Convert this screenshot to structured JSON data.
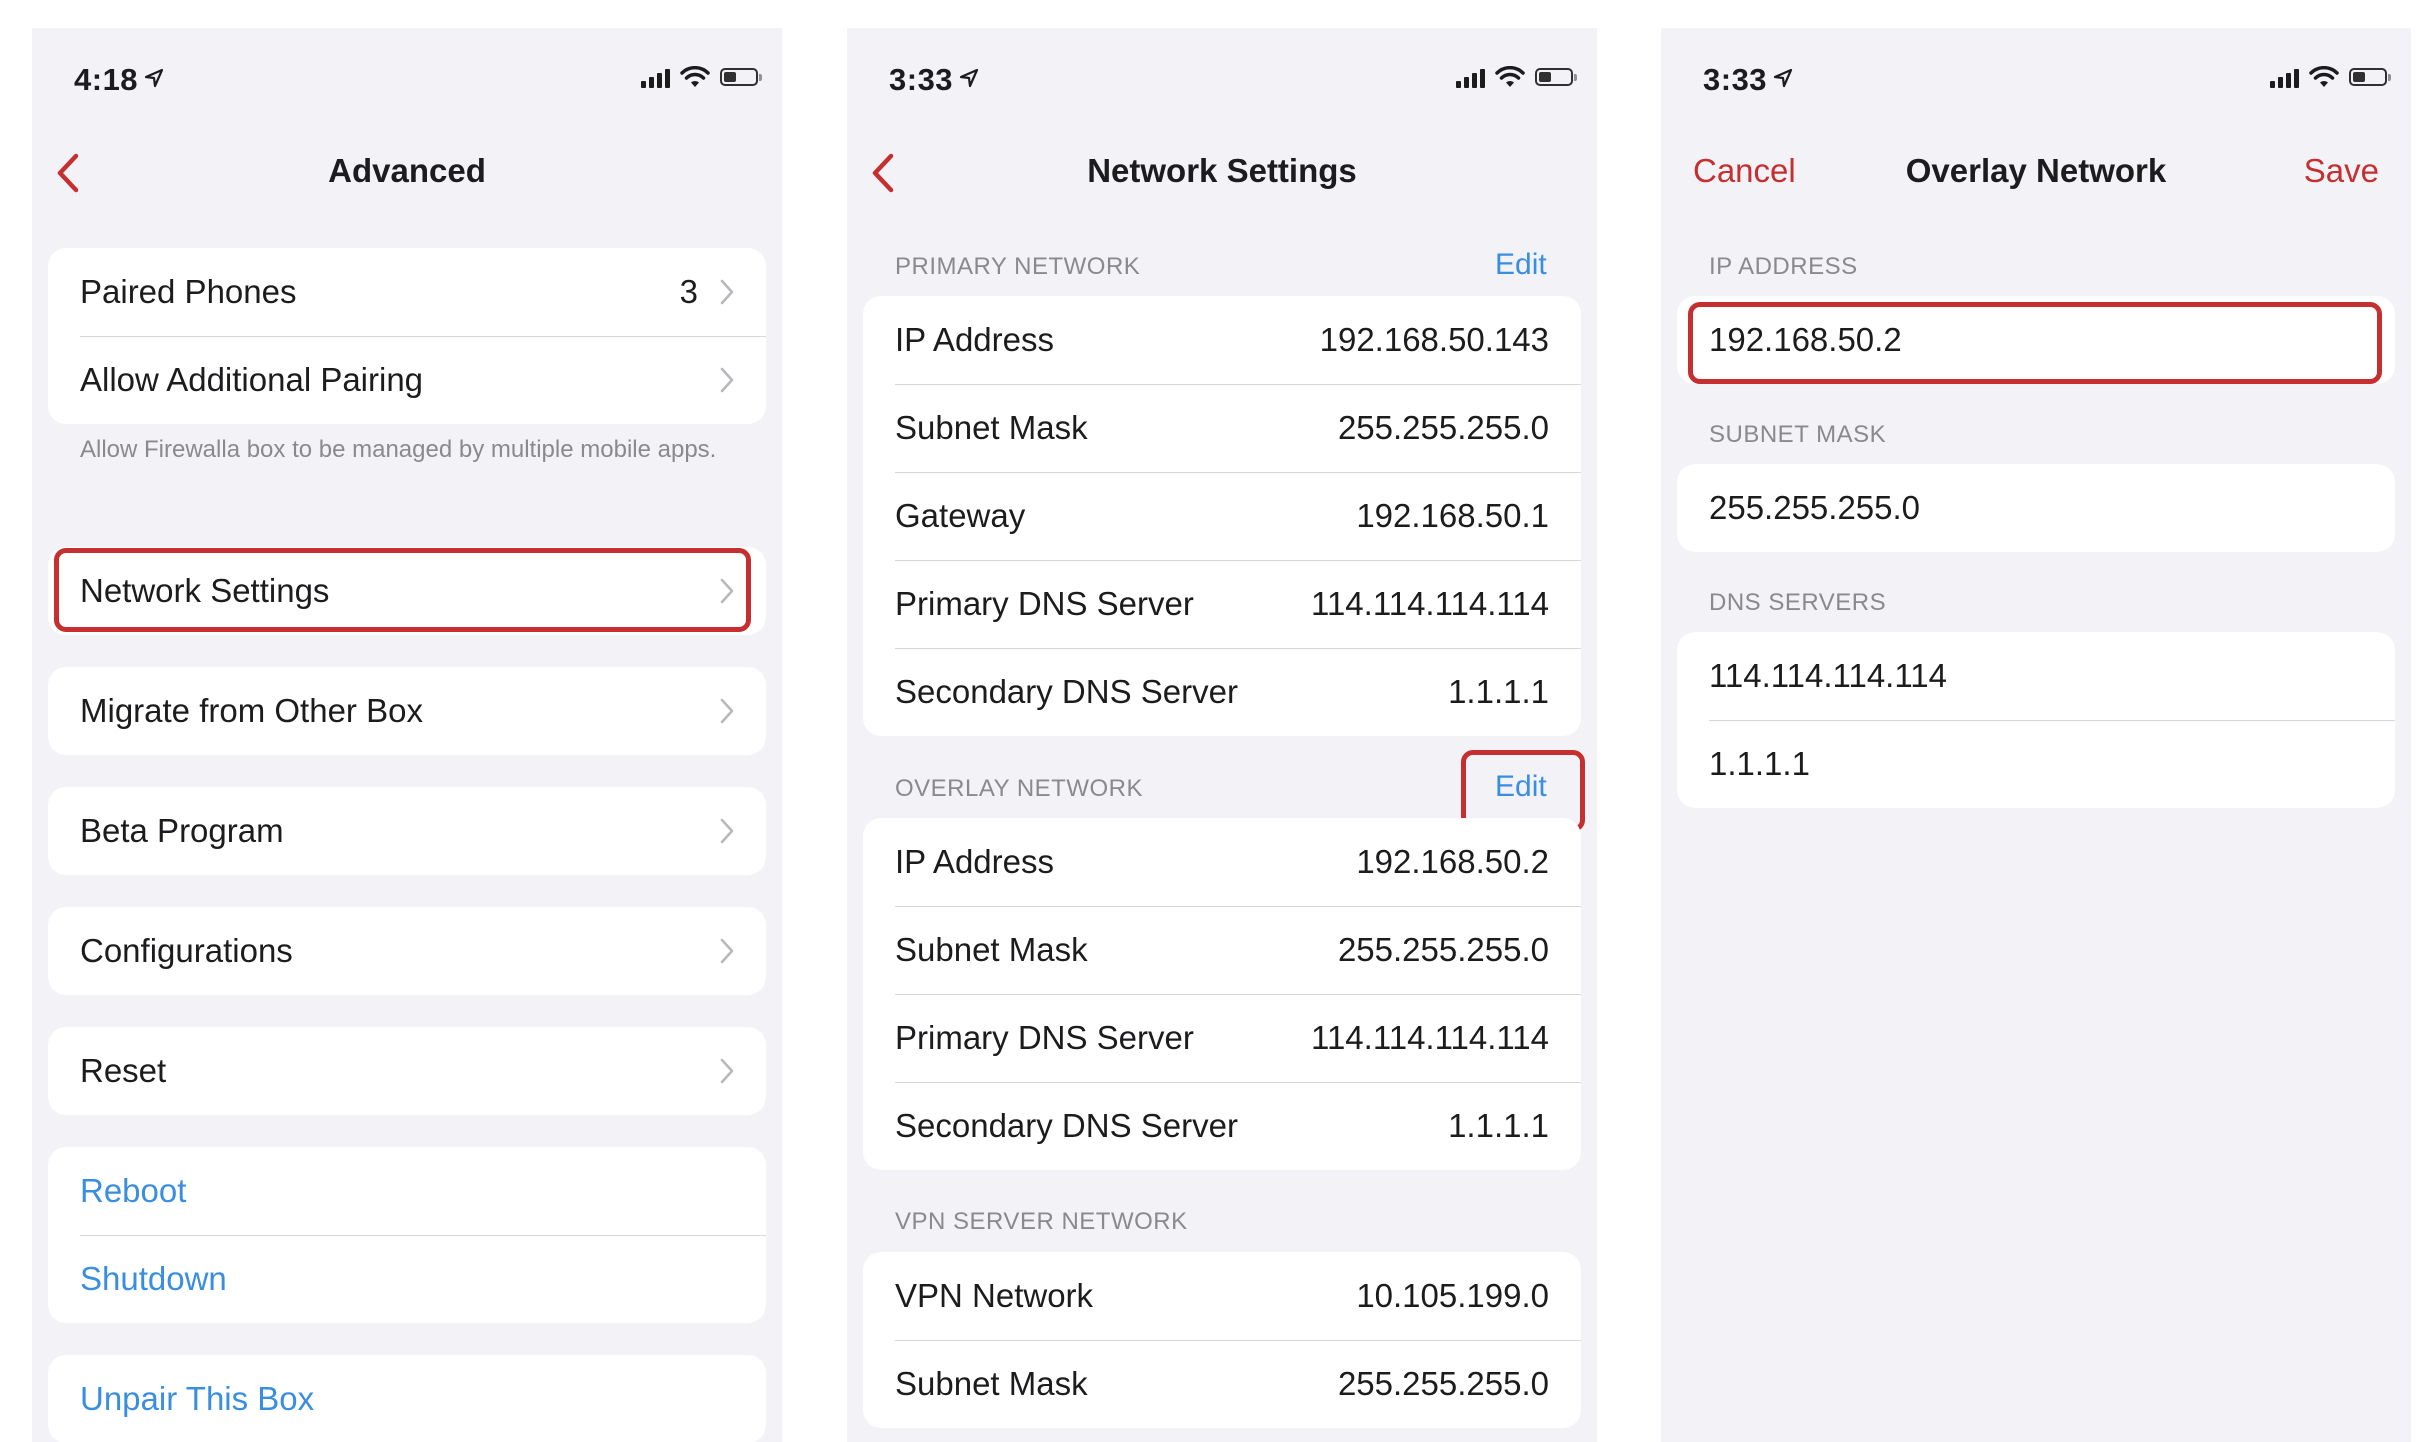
{
  "colors": {
    "accent_red": "#c62f2f",
    "link_blue": "#3a8ee0",
    "secondary_text": "#8a8a8e",
    "background": "#f2f2f7"
  },
  "screen1": {
    "time": "4:18",
    "title": "Advanced",
    "paired_phones": {
      "label": "Paired Phones",
      "count": "3"
    },
    "allow_pairing": {
      "label": "Allow Additional Pairing"
    },
    "pairing_note": "Allow Firewalla box to be managed by multiple mobile apps.",
    "network_settings": "Network Settings",
    "migrate": "Migrate from Other Box",
    "beta": "Beta Program",
    "configurations": "Configurations",
    "reset": "Reset",
    "reboot": "Reboot",
    "shutdown": "Shutdown",
    "unpair": "Unpair This Box"
  },
  "screen2": {
    "time": "3:33",
    "title": "Network Settings",
    "primary": {
      "header": "PRIMARY NETWORK",
      "edit": "Edit",
      "rows": [
        {
          "label": "IP Address",
          "value": "192.168.50.143"
        },
        {
          "label": "Subnet Mask",
          "value": "255.255.255.0"
        },
        {
          "label": "Gateway",
          "value": "192.168.50.1"
        },
        {
          "label": "Primary DNS Server",
          "value": "114.114.114.114"
        },
        {
          "label": "Secondary DNS Server",
          "value": "1.1.1.1"
        }
      ]
    },
    "overlay": {
      "header": "OVERLAY NETWORK",
      "edit": "Edit",
      "rows": [
        {
          "label": "IP Address",
          "value": "192.168.50.2"
        },
        {
          "label": "Subnet Mask",
          "value": "255.255.255.0"
        },
        {
          "label": "Primary DNS Server",
          "value": "114.114.114.114"
        },
        {
          "label": "Secondary DNS Server",
          "value": "1.1.1.1"
        }
      ]
    },
    "vpn": {
      "header": "VPN SERVER NETWORK",
      "rows": [
        {
          "label": "VPN Network",
          "value": "10.105.199.0"
        },
        {
          "label": "Subnet Mask",
          "value": "255.255.255.0"
        }
      ]
    }
  },
  "screen3": {
    "time": "3:33",
    "title": "Overlay Network",
    "cancel": "Cancel",
    "save": "Save",
    "ip_header": "IP ADDRESS",
    "ip_value": "192.168.50.2",
    "subnet_header": "SUBNET MASK",
    "subnet_value": "255.255.255.0",
    "dns_header": "DNS SERVERS",
    "dns_primary": "114.114.114.114",
    "dns_secondary": "1.1.1.1"
  }
}
